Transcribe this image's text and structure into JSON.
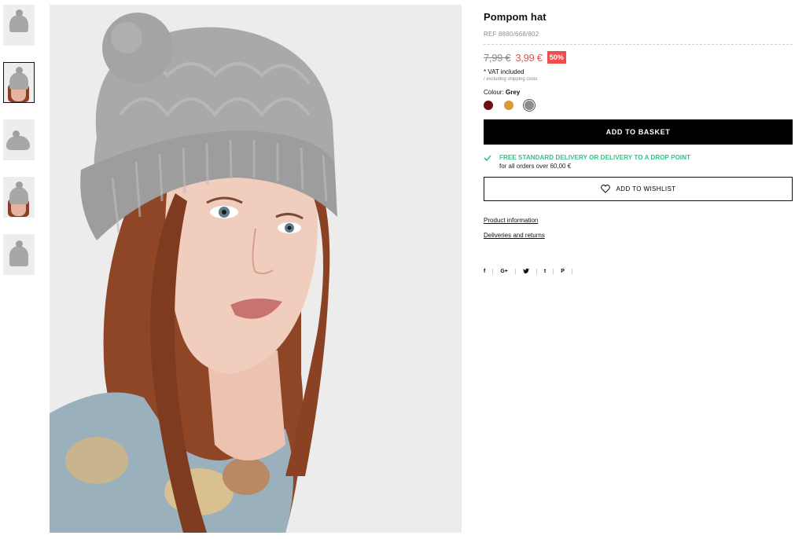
{
  "thumbnails": [
    {
      "name": "thumb-hat-only",
      "type": "hat"
    },
    {
      "name": "thumb-model",
      "type": "model",
      "active": true
    },
    {
      "name": "thumb-hat-side",
      "type": "hat"
    },
    {
      "name": "thumb-model-side",
      "type": "model"
    },
    {
      "name": "thumb-hat-front",
      "type": "hat"
    }
  ],
  "product": {
    "title": "Pompom hat",
    "ref": "REF 8880/668/802",
    "old_price": "7,99 €",
    "new_price": "3,99 €",
    "discount": "50%",
    "vat": "* VAT included",
    "shipping_note": "/ excluding shipping costs",
    "colour_label": "Colour:",
    "colour_value": "Grey",
    "swatches": [
      {
        "name": "burgundy",
        "color": "#6b1116"
      },
      {
        "name": "mustard",
        "color": "#d99a36"
      },
      {
        "name": "grey",
        "color": "#8d8d8d",
        "selected": true
      }
    ]
  },
  "buttons": {
    "basket": "ADD TO BASKET",
    "wishlist": "ADD TO WISHLIST"
  },
  "delivery": {
    "title": "FREE STANDARD DELIVERY OR DELIVERY TO A DROP POINT",
    "subtitle": "for all orders over 60,00 €",
    "accent": "#35c185"
  },
  "links": {
    "product_info": "Product information",
    "deliveries": "Deliveries and returns"
  },
  "social": {
    "facebook": "f",
    "googleplus": "G+",
    "tumblr": "t",
    "pinterest": "P"
  },
  "colors": {
    "price_red": "#e4514f",
    "badge_red": "#ee4e4e",
    "button_black": "#000000"
  }
}
